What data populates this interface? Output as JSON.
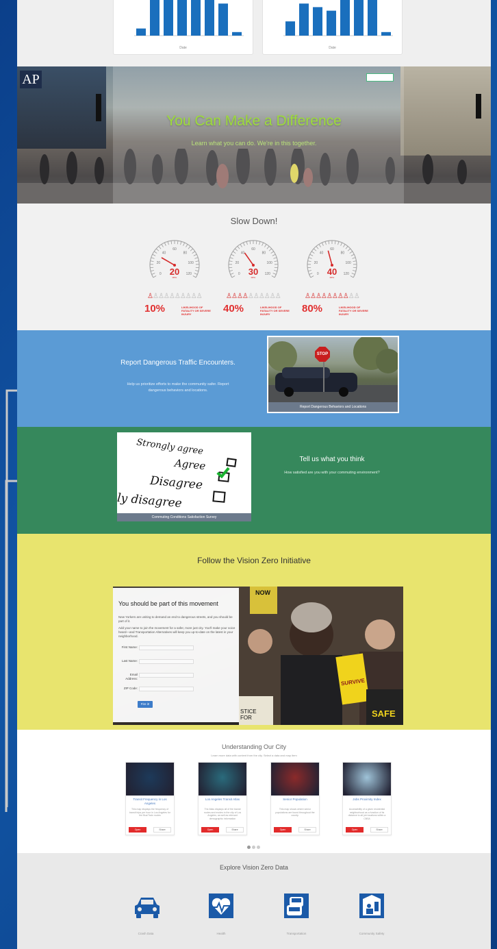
{
  "hero": {
    "title": "You Can Make a Difference",
    "subtitle": "Learn what you can do. We're in this together."
  },
  "charts": [
    {
      "xlabel": "Date",
      "values": [
        2,
        10,
        10,
        10,
        10,
        10,
        9,
        1
      ]
    },
    {
      "xlabel": "Date",
      "values": [
        4,
        9,
        8,
        7,
        10,
        10,
        10,
        1
      ]
    }
  ],
  "slow_down": {
    "title": "Slow Down!",
    "gauges": [
      {
        "speed": "20",
        "unit": "MPH",
        "percent": "10%",
        "note": "LIKELIHOOD OF FATALITY OR SEVERE INJURY"
      },
      {
        "speed": "30",
        "unit": "MPH",
        "percent": "40%",
        "note": "LIKELIHOOD OF FATALITY OR SEVERE INJURY"
      },
      {
        "speed": "40",
        "unit": "MPH",
        "percent": "80%",
        "note": "LIKELIHOOD OF FATALITY OR SEVERE INJURY"
      }
    ],
    "dial_ticks": [
      "0",
      "20",
      "40",
      "60",
      "80",
      "100",
      "120"
    ]
  },
  "report": {
    "title": "Report Dangerous Traffic Encounters.",
    "text": "Help us prioritize efforts to make the community safer. Report dangerous behaviors and locations.",
    "image_caption": "Report Dangerous Behaviors and Locations",
    "sign": "STOP"
  },
  "survey": {
    "title": "Tell us what you think",
    "text": "How satisfied are you with your commuting environment?",
    "image_caption": "Commuting Conditions Satisfaction Survey",
    "lines": [
      "Strongly agree",
      "Agree",
      "Disagree",
      "ly disagree"
    ]
  },
  "vision_zero": {
    "title": "Follow the Vision Zero Initiative",
    "form_title": "You should be part of this movement",
    "intro": "New Yorkers are uniting to demand an end to dangerous streets, and you should be part of it.",
    "intro2": "Add your name to join the movement for a safer, more just city. You'll make your voice heard—and Transportation Alternatives will keep you up-to-date on the latest in your neighborhood.",
    "fields": [
      "First Name:",
      "Last Name:",
      "Email Address:",
      "ZIP Code:"
    ],
    "button": "Fire it!",
    "signs": [
      "SURVIVE",
      "SAFE",
      "STICE FOR",
      "NOW"
    ]
  },
  "understanding": {
    "title": "Understanding Our City",
    "subtitle": "Learn more data with content from the city. Select a data and map item",
    "cards": [
      {
        "title": "Transit Frequency in Los Angeles",
        "desc": "This map displays the frequency of transit trips per hour in Los Angeles for the Bus/Train routes",
        "open": "Open",
        "share": "Share",
        "color": "#1d3a5a"
      },
      {
        "title": "Los Angeles Transit Atlas",
        "desc": "The Atlas displays all of the transit routes and modes in the city of Los Angeles, as well as relevant demographic information",
        "open": "Open",
        "share": "Share",
        "color": "#2a6b7c"
      },
      {
        "title": "Senior Population",
        "desc": "This map shows where senior populations are found throughout the county.",
        "open": "Open",
        "share": "Share",
        "color": "#8b2a2a"
      },
      {
        "title": "Jobs Proximity Index",
        "desc": "Accessibility of a given residential neighborhood as a function of its distance to all job locations within a CBSA",
        "open": "Open",
        "share": "Share",
        "color": "#9fc3d8"
      }
    ]
  },
  "explore": {
    "title": "Explore Vision Zero Data",
    "items": [
      {
        "label": "Crash Data",
        "icon": "car-icon"
      },
      {
        "label": "Health",
        "icon": "heart-pulse-icon"
      },
      {
        "label": "Transportation",
        "icon": "traffic-icon"
      },
      {
        "label": "Community Safety",
        "icon": "community-safety-icon"
      }
    ],
    "accent": "#1b5aa8"
  }
}
